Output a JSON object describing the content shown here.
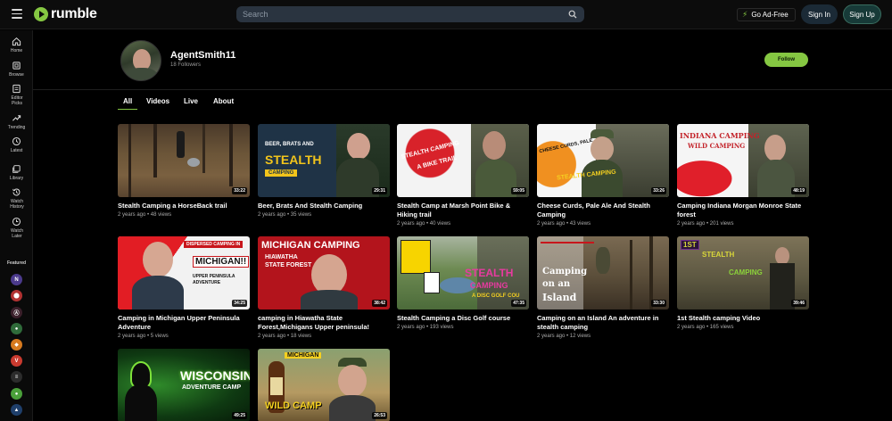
{
  "header": {
    "logo_text": "rumble",
    "search_placeholder": "Search",
    "go_ad_free": "Go Ad-Free",
    "sign_in": "Sign In",
    "sign_up": "Sign Up"
  },
  "sidebar": {
    "items": [
      {
        "label": "Home",
        "icon": "home-icon"
      },
      {
        "label": "Browse",
        "icon": "browse-icon"
      },
      {
        "label": "Editor Picks",
        "icon": "editor-picks-icon"
      },
      {
        "label": "Trending",
        "icon": "trending-icon"
      },
      {
        "label": "Latest",
        "icon": "clock-icon"
      },
      {
        "label": "Library",
        "icon": "library-icon"
      },
      {
        "label": "Watch History",
        "icon": "history-icon"
      },
      {
        "label": "Watch Later",
        "icon": "watch-later-icon"
      }
    ],
    "featured_label": "Featured",
    "featured_colors": [
      "#4b3a8c",
      "#b23232",
      "#3a1f2a",
      "#2f6b3a",
      "#d77a1f",
      "#c93a2f",
      "#2c2c2c",
      "#4aa03a",
      "#1f3f6b"
    ]
  },
  "channel": {
    "name": "AgentSmith11",
    "followers": "18 Followers",
    "follow_label": "Follow"
  },
  "tabs": [
    "All",
    "Videos",
    "Live",
    "About"
  ],
  "videos": [
    {
      "title_line1": "Stealth Camping a HorseBack trail",
      "title_line2": "",
      "meta": "2 years ago • 48 views",
      "duration": "33:22"
    },
    {
      "title_line1": "Beer, Brats And Stealth Camping",
      "title_line2": "",
      "meta": "2 years ago • 35 views",
      "duration": "29:31",
      "overlay1": "BEER, BRATS AND",
      "overlay2": "STEALTH",
      "overlay3": "CAMPING"
    },
    {
      "title_line1": "Stealth Camp at Marsh Point Bike &",
      "title_line2": "Hiking trail",
      "meta": "2 years ago • 40 views",
      "duration": "59:05",
      "overlay1": "STEALTH CAMPING",
      "overlay2": "A BIKE TRAIL"
    },
    {
      "title_line1": "Cheese Curds, Pale Ale And Stealth",
      "title_line2": "Camping",
      "meta": "2 years ago • 43 views",
      "duration": "33:26",
      "overlay1": "CHEESE CURDS, PALE",
      "overlay2": "STEALTH CAMPING"
    },
    {
      "title_line1": "Camping Indiana Morgan Monroe State",
      "title_line2": "forest",
      "meta": "2 years ago • 201 views",
      "duration": "48:19",
      "overlay1": "INDIANA CAMPING",
      "overlay2": "WILD CAMPING"
    },
    {
      "title_line1": "Camping in Michigan Upper Peninsula",
      "title_line2": "Adventure",
      "meta": "2 years ago • 5 views",
      "duration": "34:25",
      "overlay1": "DISPERSED CAMPING IN",
      "overlay2": "MICHIGAN!!",
      "overlay3": "UPPER PENINSULA ADVENTURE"
    },
    {
      "title_line1": "camping in Hiawatha State",
      "title_line2": "Forest,Michigans Upper peninsula!",
      "meta": "2 years ago • 18 views",
      "duration": "38:42",
      "overlay1": "MICHIGAN CAMPING",
      "overlay2": "HIAWATHA",
      "overlay3": "STATE FOREST"
    },
    {
      "title_line1": "Stealth Camping a Disc Golf course",
      "title_line2": "",
      "meta": "2 years ago • 193 views",
      "duration": "47:35",
      "overlay1": "STEALTH",
      "overlay2": "CAMPING",
      "overlay3": "A DISC GOLF COU"
    },
    {
      "title_line1": "Camping on an Island An adventure in",
      "title_line2": "stealth camping",
      "meta": "2 years ago • 12 views",
      "duration": "33:30",
      "overlay1": "Camping",
      "overlay2": "on an",
      "overlay3": "Island"
    },
    {
      "title_line1": "1st Stealth camping Video",
      "title_line2": "",
      "meta": "2 years ago • 165 views",
      "duration": "39:46",
      "overlay1": "1ST",
      "overlay2": "STEALTH",
      "overlay3": "CAMPING"
    },
    {
      "title_line1": "",
      "title_line2": "",
      "meta": "",
      "duration": "49:25",
      "overlay1": "WISCONSIN",
      "overlay2": "ADVENTURE CAMP"
    },
    {
      "title_line1": "",
      "title_line2": "",
      "meta": "",
      "duration": "26:53",
      "overlay1": "MICHIGAN",
      "overlay2": "WILD CAMP"
    }
  ]
}
